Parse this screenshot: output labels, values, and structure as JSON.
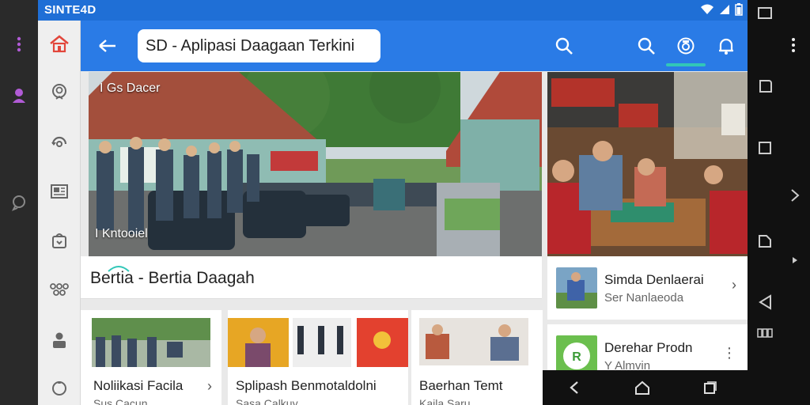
{
  "status_bar": {
    "brand": "SINTE4D"
  },
  "app_bar": {
    "title": "SD - Aplipasi Daagaan Terkini"
  },
  "hero_main": {
    "top_label": "I Gs Dacer",
    "bottom_label": "I Kntooiel"
  },
  "section": {
    "title": "Bertia - Bertia Daagah"
  },
  "side_list": [
    {
      "title": "Simda Denlaerai",
      "subtitle": "Ser Nanlaeoda",
      "trail": "›"
    },
    {
      "title": "Derehar Prodn",
      "subtitle": "Y Almvin",
      "trail": "⋮"
    }
  ],
  "bottom_cards": [
    {
      "title": "Noliikasi Facila",
      "subtitle": "Sus Cacun"
    },
    {
      "title": "Splipash Benmotaldolni",
      "subtitle": "Sasa Calkuy"
    },
    {
      "title": "Baerhan Temt",
      "subtitle": "Kaila Saru"
    }
  ],
  "colors": {
    "status_bar": "#1f6fd6",
    "app_bar": "#2a7be6",
    "accent_teal": "#32c7b8",
    "sidebar_bg": "#efefef",
    "home_icon": "#e2463b",
    "left_strip_icon": "#b15bd6"
  }
}
